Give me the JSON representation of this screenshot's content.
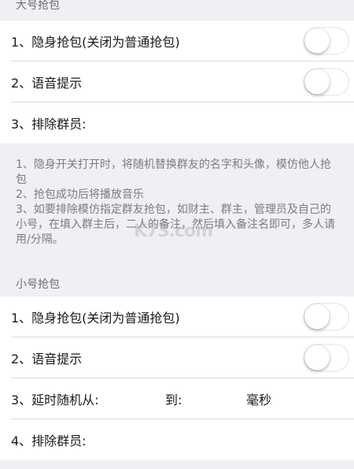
{
  "big_section": {
    "header": "大号抢包",
    "rows": [
      {
        "label": "1、隐身抢包(关闭为普通抢包)",
        "toggle": false
      },
      {
        "label": "2、语音提示",
        "toggle": false
      },
      {
        "label": "3、排除群员:"
      }
    ]
  },
  "notes": {
    "lines": [
      "1、隐身开关打开时，将随机替换群友的名字和头像，模仿他人抢包",
      "2、抢包成功后将播放音乐",
      "3、如要排除模仿指定群友抢包，如财主、群主，管理员及自己的小号，在填入群主后，二人的备注，然后填入备注名即可，多人请用/分隔。"
    ],
    "watermark": "K73.com"
  },
  "small_section": {
    "header": "小号抢包",
    "rows": [
      {
        "label": "1、隐身抢包(关闭为普通抢包)",
        "toggle": false
      },
      {
        "label": "2、语音提示",
        "toggle": false
      },
      {
        "label": "3、延时随机从:",
        "to_label": "到:",
        "unit_label": "毫秒"
      },
      {
        "label": "4、排除群员:"
      }
    ]
  }
}
